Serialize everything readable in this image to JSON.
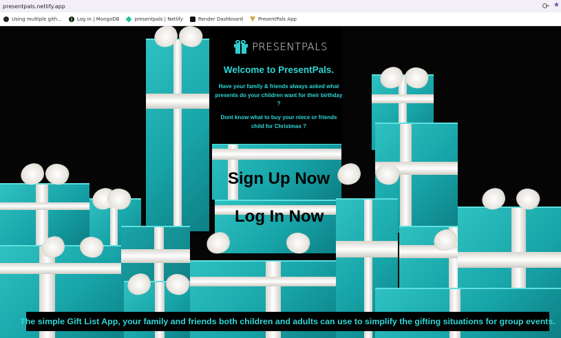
{
  "browser": {
    "url": "presentpals.netlify.app",
    "bookmarks": [
      {
        "label": "Using multiple gith...",
        "icon": "github-icon"
      },
      {
        "label": "Log in | MongoDB",
        "icon": "mongodb-icon"
      },
      {
        "label": "presentpals | Netlify",
        "icon": "netlify-icon"
      },
      {
        "label": "Render Dashboard",
        "icon": "render-icon"
      },
      {
        "label": "PresentPals App",
        "icon": "presentpals-icon"
      }
    ]
  },
  "hero": {
    "logo_text": "PRESENTPALS",
    "welcome": "Welcome to PresentPals.",
    "intro_1": "Have your family & friends always asked what presents do your children want for their birthday ?",
    "intro_2": "Dont know what to buy your niece or friends child for Christmas ?",
    "signup_label": "Sign Up Now",
    "login_label": "Log In Now",
    "tagline": "The simple Gift List App, your family and friends both children and adults can use to simplify the gifting situations for group events."
  },
  "colors": {
    "accent": "#2fd6d6",
    "gift_teal": "#17a4a8",
    "ribbon": "#f2f0ea",
    "background": "#000000"
  }
}
